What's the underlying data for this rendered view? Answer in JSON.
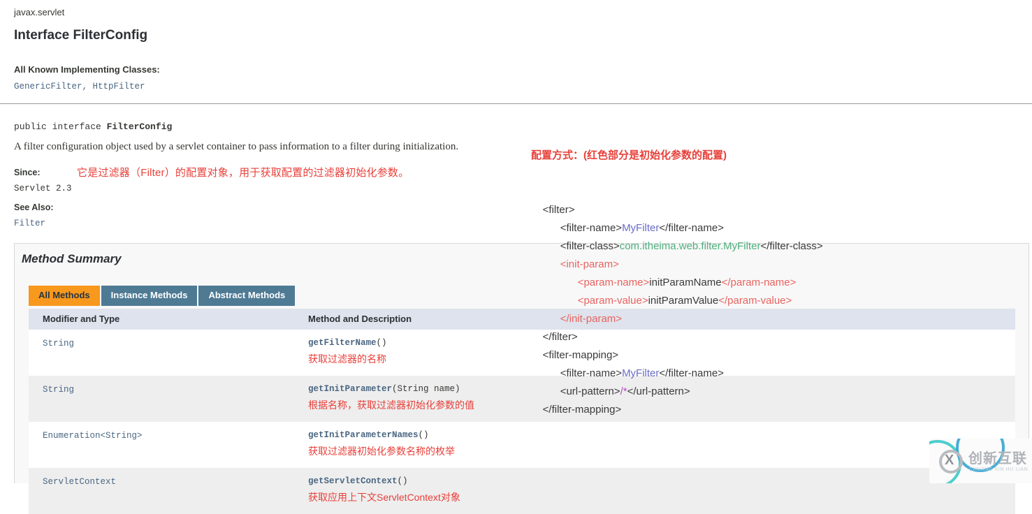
{
  "header": {
    "package": "javax.servlet",
    "title": "Interface FilterConfig",
    "known_label": "All Known Implementing Classes:",
    "known_classes": "GenericFilter, HttpFilter"
  },
  "declaration": {
    "modifiers": "public interface ",
    "type_name": "FilterConfig",
    "description": "A filter configuration object used by a servlet container to pass information to a filter during initialization.",
    "annotation_cn": "它是过滤器（Filter）的配置对象，用于获取配置的过滤器初始化参数。",
    "since_label": "Since:",
    "since_value": "Servlet 2.3",
    "see_also_label": "See Also:",
    "see_also_value": "Filter"
  },
  "method_summary": {
    "title": "Method Summary",
    "tabs": [
      {
        "label": "All Methods",
        "active": true
      },
      {
        "label": "Instance Methods",
        "active": false
      },
      {
        "label": "Abstract Methods",
        "active": false
      }
    ],
    "columns": [
      "Modifier and Type",
      "Method and Description"
    ],
    "rows": [
      {
        "type": "String",
        "method_name": "getFilterName",
        "method_args": "()",
        "description_cn": "获取过滤器的名称"
      },
      {
        "type": "String",
        "method_name": "getInitParameter",
        "method_args": "(String  name)",
        "description_cn": "根据名称，获取过滤器初始化参数的值"
      },
      {
        "type": "Enumeration<String>",
        "method_name": "getInitParameterNames",
        "method_args": "()",
        "description_cn": "获取过滤器初始化参数名称的枚举"
      },
      {
        "type": "ServletContext",
        "method_name": "getServletContext",
        "method_args": "()",
        "description_cn": "获取应用上下文ServletContext对象"
      }
    ]
  },
  "xml_note": {
    "heading": "配置方式：",
    "heading_paren": "(红色部分是初始化参数的配置)",
    "lines": [
      {
        "indent": 4,
        "parts": [
          {
            "t": "<filter>",
            "c": "tag-dark"
          }
        ]
      },
      {
        "indent": 10,
        "parts": [
          {
            "t": "<filter-name>",
            "c": "tag-dark"
          },
          {
            "t": "MyFilter",
            "c": "val-blue"
          },
          {
            "t": "</filter-name>",
            "c": "tag-dark"
          }
        ]
      },
      {
        "indent": 10,
        "parts": [
          {
            "t": "<filter-class>",
            "c": "tag-dark"
          },
          {
            "t": "com.itheima.web.filter.MyFilter",
            "c": "val-green"
          },
          {
            "t": "</filter-class>",
            "c": "tag-dark"
          }
        ]
      },
      {
        "indent": 10,
        "parts": [
          {
            "t": "<init-param>",
            "c": "tag-red"
          }
        ]
      },
      {
        "indent": 16,
        "parts": [
          {
            "t": "<param-name>",
            "c": "tag-red"
          },
          {
            "t": "initParamName",
            "c": "val-dark"
          },
          {
            "t": "</param-name>",
            "c": "tag-red"
          }
        ]
      },
      {
        "indent": 16,
        "parts": [
          {
            "t": "<param-value>",
            "c": "tag-red"
          },
          {
            "t": "initParamValue",
            "c": "val-dark"
          },
          {
            "t": "</param-value>",
            "c": "tag-red"
          }
        ]
      },
      {
        "indent": 10,
        "parts": [
          {
            "t": "</init-param>",
            "c": "tag-red"
          }
        ]
      },
      {
        "indent": 4,
        "parts": [
          {
            "t": "</filter>",
            "c": "tag-dark"
          }
        ]
      },
      {
        "indent": 4,
        "parts": [
          {
            "t": "<filter-mapping>",
            "c": "tag-dark"
          }
        ]
      },
      {
        "indent": 10,
        "parts": [
          {
            "t": "<filter-name>",
            "c": "tag-dark"
          },
          {
            "t": "MyFilter",
            "c": "val-blue"
          },
          {
            "t": "</filter-name>",
            "c": "tag-dark"
          }
        ]
      },
      {
        "indent": 10,
        "parts": [
          {
            "t": "<url-pattern>",
            "c": "tag-dark"
          },
          {
            "t": "/*",
            "c": "val-purple"
          },
          {
            "t": "</url-pattern>",
            "c": "tag-dark"
          }
        ]
      },
      {
        "indent": 4,
        "parts": [
          {
            "t": "</filter-mapping>",
            "c": "tag-dark"
          }
        ]
      }
    ]
  },
  "watermark": {
    "mark": "X",
    "name_cn": "创新互联",
    "name_pinyin": "CHUANG XIN HU LIAN"
  },
  "colors": {
    "accent_orange": "#f8981d",
    "tab_blue": "#4e7a94",
    "link_blue": "#4a6782",
    "annotation_red": "#e8403a",
    "xml_tag_red": "#e8635f",
    "xml_value_green": "#4caf7d",
    "xml_value_blue": "#6b6bc8",
    "table_header": "#dee3ed"
  }
}
